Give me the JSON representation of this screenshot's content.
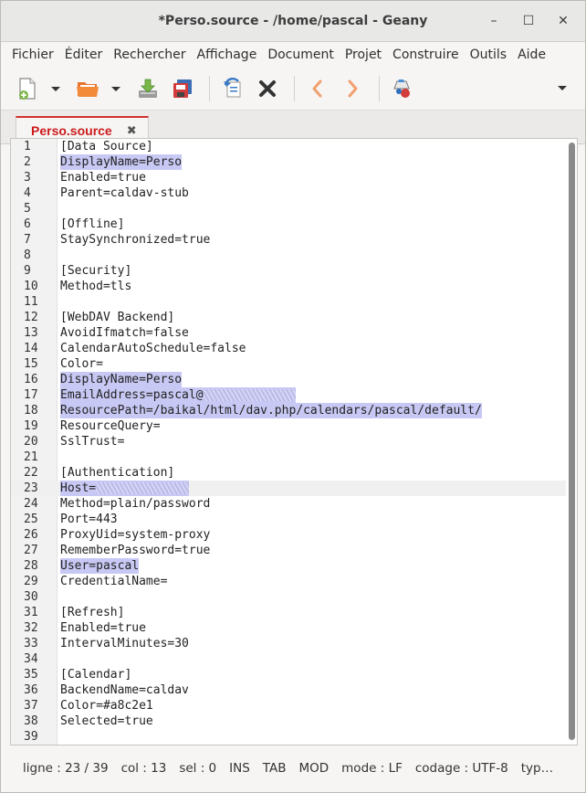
{
  "window": {
    "title": "*Perso.source - /home/pascal - Geany",
    "minimize": "–",
    "maximize": "☐",
    "close": "✕"
  },
  "menubar": [
    "Fichier",
    "Éditer",
    "Rechercher",
    "Affichage",
    "Document",
    "Projet",
    "Construire",
    "Outils",
    "Aide"
  ],
  "tab": {
    "label": "Perso.source",
    "close": "✖"
  },
  "accent": "#cc1b1b",
  "editor": {
    "lines": [
      {
        "n": "1",
        "text": "[Data Source]"
      },
      {
        "n": "2",
        "text": "DisplayName=Perso",
        "hl": true
      },
      {
        "n": "3",
        "text": "Enabled=true"
      },
      {
        "n": "4",
        "text": "Parent=caldav-stub"
      },
      {
        "n": "5",
        "text": ""
      },
      {
        "n": "6",
        "text": "[Offline]"
      },
      {
        "n": "7",
        "text": "StaySynchronized=true"
      },
      {
        "n": "8",
        "text": ""
      },
      {
        "n": "9",
        "text": "[Security]"
      },
      {
        "n": "10",
        "text": "Method=tls"
      },
      {
        "n": "11",
        "text": ""
      },
      {
        "n": "12",
        "text": "[WebDAV Backend]"
      },
      {
        "n": "13",
        "text": "AvoidIfmatch=false"
      },
      {
        "n": "14",
        "text": "CalendarAutoSchedule=false"
      },
      {
        "n": "15",
        "text": "Color="
      },
      {
        "n": "16",
        "text": "DisplayName=Perso",
        "hl": true
      },
      {
        "n": "17",
        "text": "EmailAddress=pascal@",
        "hl": true,
        "blur": 13
      },
      {
        "n": "18",
        "text": "ResourcePath=/baikal/html/dav.php/calendars/pascal/default/",
        "hl": true
      },
      {
        "n": "19",
        "text": "ResourceQuery="
      },
      {
        "n": "20",
        "text": "SslTrust="
      },
      {
        "n": "21",
        "text": ""
      },
      {
        "n": "22",
        "text": "[Authentication]"
      },
      {
        "n": "23",
        "text": "Host=",
        "hl": true,
        "blur": 13,
        "current": true
      },
      {
        "n": "24",
        "text": "Method=plain/password"
      },
      {
        "n": "25",
        "text": "Port=443"
      },
      {
        "n": "26",
        "text": "ProxyUid=system-proxy"
      },
      {
        "n": "27",
        "text": "RememberPassword=true"
      },
      {
        "n": "28",
        "text": "User=pascal",
        "hl": true
      },
      {
        "n": "29",
        "text": "CredentialName="
      },
      {
        "n": "30",
        "text": ""
      },
      {
        "n": "31",
        "text": "[Refresh]"
      },
      {
        "n": "32",
        "text": "Enabled=true"
      },
      {
        "n": "33",
        "text": "IntervalMinutes=30"
      },
      {
        "n": "34",
        "text": ""
      },
      {
        "n": "35",
        "text": "[Calendar]"
      },
      {
        "n": "36",
        "text": "BackendName=caldav"
      },
      {
        "n": "37",
        "text": "Color=#a8c2e1"
      },
      {
        "n": "38",
        "text": "Selected=true"
      },
      {
        "n": "39",
        "text": ""
      }
    ]
  },
  "status": {
    "line": "ligne : 23 / 39",
    "col": "col : 13",
    "sel": "sel : 0",
    "ins": "INS",
    "tab": "TAB",
    "mod": "MOD",
    "mode": "mode : LF",
    "encoding": "codage : UTF-8",
    "type": "typ…"
  }
}
